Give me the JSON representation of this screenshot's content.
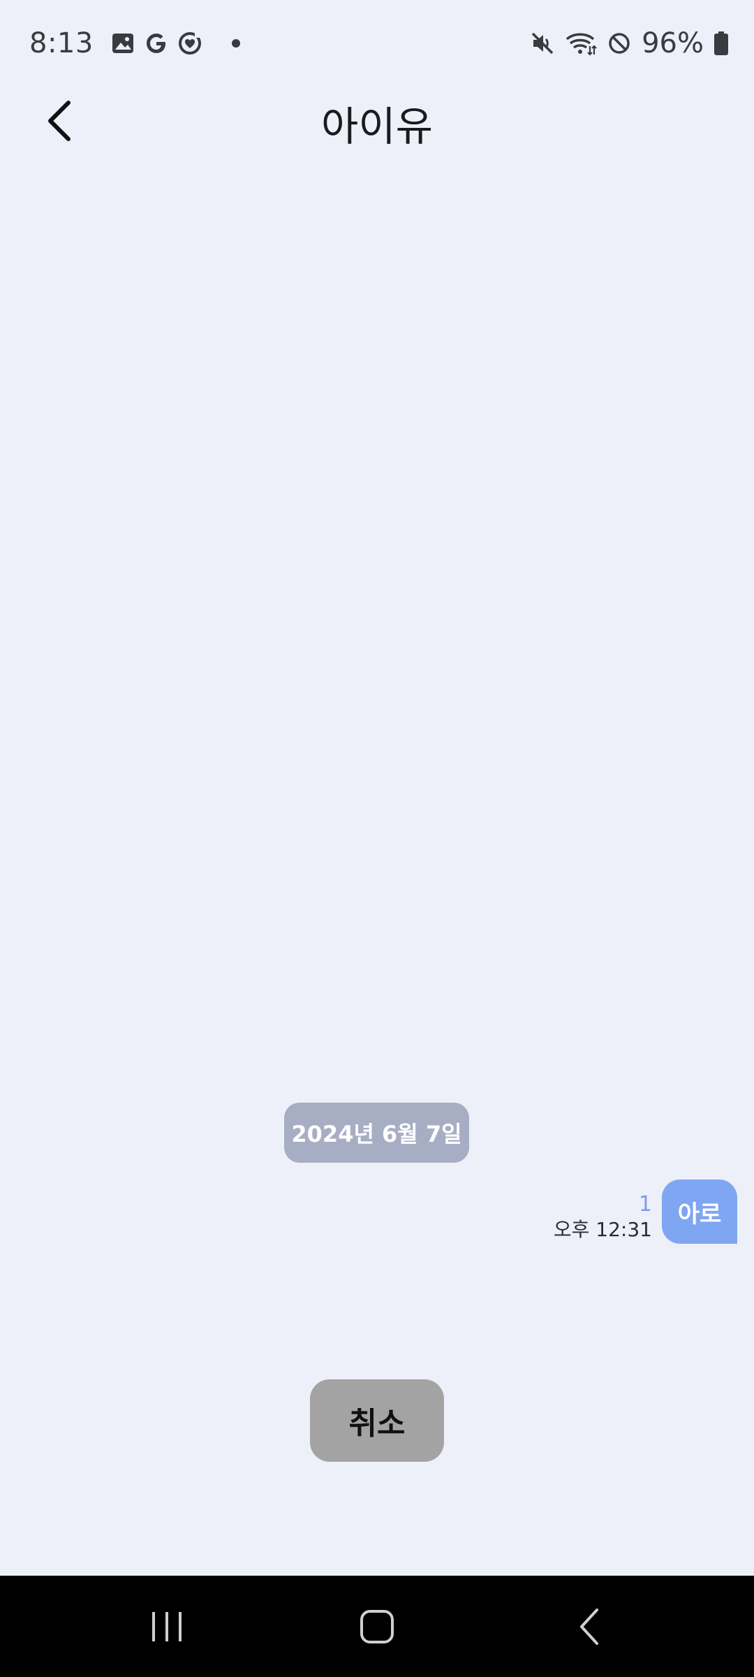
{
  "status_bar": {
    "time": "8:13",
    "battery": "96%",
    "left_icons": [
      "gallery-icon",
      "google-icon",
      "heart-circle-icon",
      "dot-icon"
    ],
    "right_icons": [
      "mute-icon",
      "wifi-icon",
      "do-not-disturb-icon",
      "battery-icon"
    ]
  },
  "header": {
    "title": "아이유",
    "back_icon": "chevron-left-icon"
  },
  "conversation": {
    "date_chip": "2024년 6월 7일",
    "messages": [
      {
        "text": "아로",
        "unread": "1",
        "time": "오후 12:31",
        "direction": "outgoing"
      }
    ]
  },
  "actions": {
    "cancel_label": "취소"
  },
  "nav_bar": {
    "recents_icon": "recents-icon",
    "home_icon": "home-icon",
    "back_icon": "back-icon"
  },
  "colors": {
    "background": "#EEF0F9",
    "bubble": "#7FA6F3",
    "date_chip": "#A7AEC4",
    "cancel_button": "#A3A3A3",
    "unread": "#7C9DEB"
  }
}
